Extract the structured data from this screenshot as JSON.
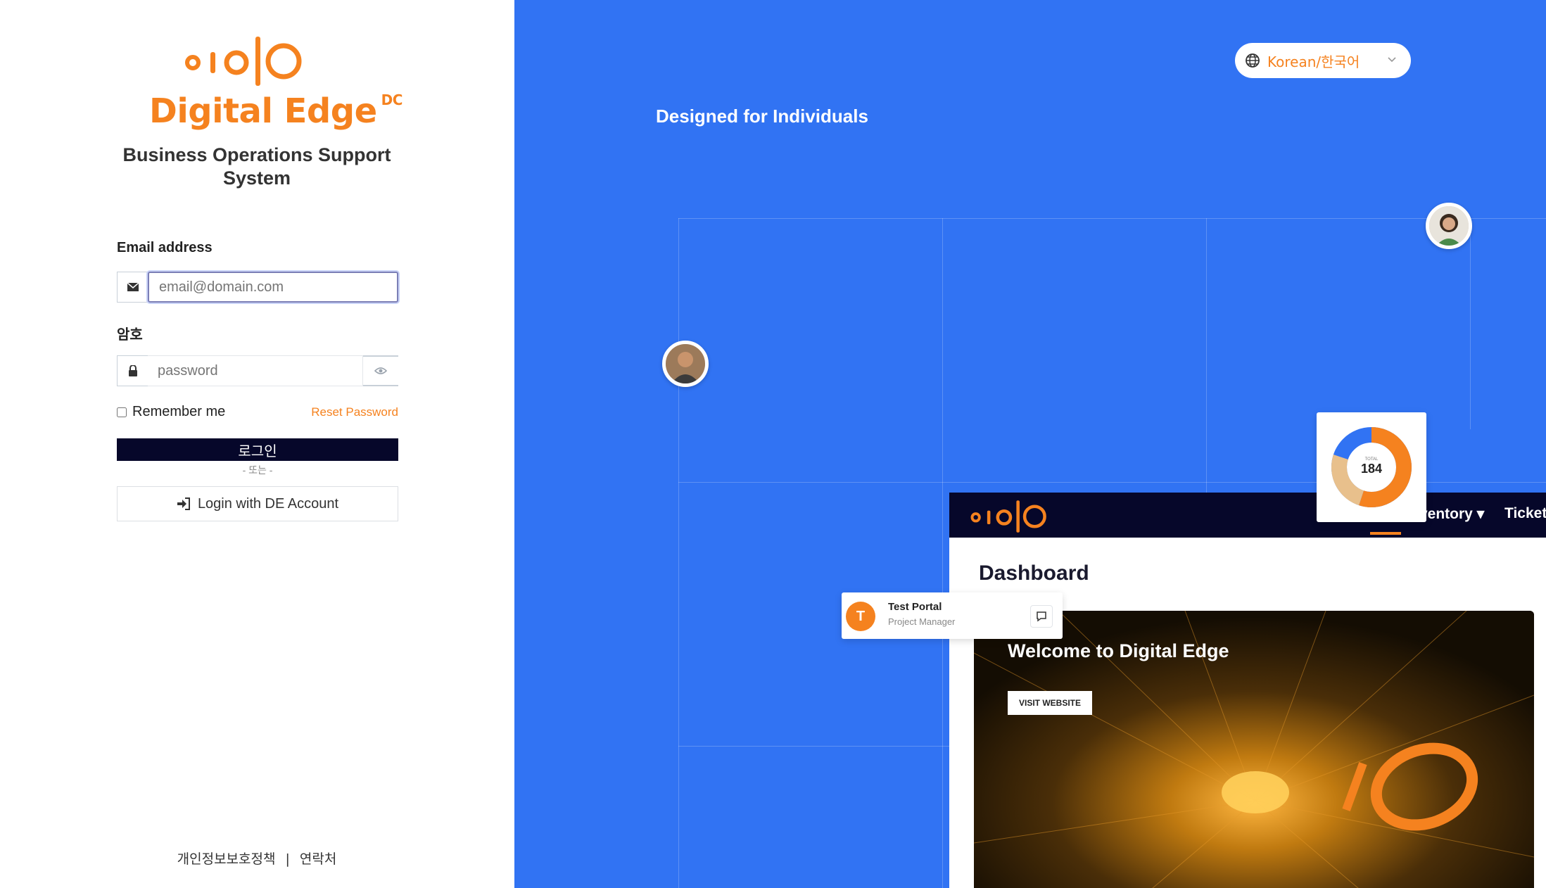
{
  "brand": {
    "name": "Digital Edge",
    "superscript": "DC",
    "app_title": "Business Operations Support System",
    "color": "#f5821f"
  },
  "login": {
    "email_label": "Email address",
    "email_placeholder": "email@domain.com",
    "password_label": "암호",
    "password_placeholder": "password",
    "remember_label": "Remember me",
    "reset_label": "Reset Password",
    "login_button": "로그인",
    "or_text": "- 또는 -",
    "de_login_button": "Login with DE Account"
  },
  "footer": {
    "privacy": "개인정보보호정책",
    "separator": "|",
    "contact": "연락처"
  },
  "promo": {
    "language": "Korean/한국어",
    "tagline": "Designed for Individuals",
    "screen": {
      "nav_items": [
        "ventory",
        "Ticket"
      ],
      "dashboard_title": "Dashboard",
      "hero_title": "Welcome to Digital Edge",
      "visit_button": "VISIT WEBSITE"
    },
    "donut": {
      "total_label": "TOTAL",
      "value": "184",
      "segments": [
        55,
        25,
        20
      ],
      "colors": [
        "#f5821f",
        "#e8c08c",
        "#3173f3"
      ]
    },
    "user_card": {
      "initial": "T",
      "name": "Test Portal",
      "role": "Project Manager"
    }
  },
  "colors": {
    "accent": "#f5821f",
    "background_right": "#3173f3",
    "dark": "#06072a"
  },
  "icons": [
    "envelope-icon",
    "lock-icon",
    "eye-icon",
    "sign-in-icon",
    "globe-icon",
    "chevron-down-icon",
    "chat-icon"
  ]
}
